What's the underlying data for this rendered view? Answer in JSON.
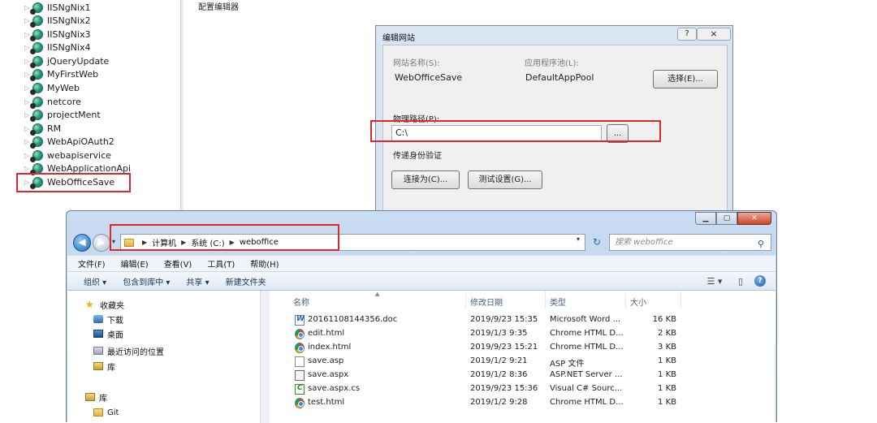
{
  "iis_tree": {
    "sites": [
      "IISNgNix1",
      "IISNgNix2",
      "IISNgNix3",
      "IISNgNix4",
      "jQueryUpdate",
      "MyFirstWeb",
      "MyWeb",
      "netcore",
      "projectMent",
      "RM",
      "WebApiOAuth2",
      "webapiservice",
      "WebApplicationApi",
      "WebOfficeSave"
    ],
    "selected": "WebOfficeSave"
  },
  "right_panel": {
    "title": "配置编辑器"
  },
  "edit_dialog": {
    "title": "编辑网站",
    "help_label": "?",
    "close_label": "×",
    "site_name_label": "网站名称(S):",
    "site_name_value": "WebOfficeSave",
    "app_pool_label": "应用程序池(L):",
    "app_pool_value": "DefaultAppPool",
    "select_button": "选择(E)...",
    "physical_path_label": "物理路径(P):",
    "physical_path_value": "C:\\",
    "browse_button": "...",
    "pass_through_label": "传递身份验证",
    "connect_as_button": "连接为(C)...",
    "test_settings_button": "测试设置(G)..."
  },
  "explorer": {
    "caption": {
      "min": "▁",
      "max": "▢",
      "close": "✕"
    },
    "nav": {
      "back": "◀",
      "forward": "▶",
      "recent": "▾"
    },
    "breadcrumb": [
      "计算机",
      "系统 (C:)",
      "weboffice"
    ],
    "address_dropdown": "▾",
    "refresh": "↻",
    "search_placeholder": "搜索 weboffice",
    "menu": [
      "文件(F)",
      "编辑(E)",
      "查看(V)",
      "工具(T)",
      "帮助(H)"
    ],
    "toolbar": [
      "组织 ▾",
      "包含到库中 ▾",
      "共享 ▾",
      "新建文件夹"
    ],
    "toolbar_icons": {
      "view": "☰ ▾",
      "preview": "▯",
      "help": "?"
    },
    "nav_pane": {
      "favorites": "收藏夹",
      "downloads": "下载",
      "desktop": "桌面",
      "recent": "最近访问的位置",
      "library_fav": "库",
      "libraries": "库",
      "git": "Git"
    },
    "columns": {
      "name": "名称",
      "modified": "修改日期",
      "type": "类型",
      "size": "大小"
    },
    "files": [
      {
        "icon": "word-doc-icon",
        "name": "20161108144356.doc",
        "modified": "2019/9/23 15:35",
        "type": "Microsoft Word ...",
        "size": "16 KB"
      },
      {
        "icon": "chrome-html-icon",
        "name": "edit.html",
        "modified": "2019/1/3 9:35",
        "type": "Chrome HTML D...",
        "size": "2 KB"
      },
      {
        "icon": "chrome-html-icon",
        "name": "index.html",
        "modified": "2019/9/23 15:21",
        "type": "Chrome HTML D...",
        "size": "3 KB"
      },
      {
        "icon": "asp-file-icon",
        "name": "save.asp",
        "modified": "2019/1/2 9:21",
        "type": "ASP 文件",
        "size": "1 KB"
      },
      {
        "icon": "aspx-file-icon",
        "name": "save.aspx",
        "modified": "2019/1/2 8:36",
        "type": "ASP.NET Server ...",
        "size": "1 KB"
      },
      {
        "icon": "csharp-file-icon",
        "name": "save.aspx.cs",
        "modified": "2019/9/23 15:36",
        "type": "Visual C# Sourc...",
        "size": "1 KB"
      },
      {
        "icon": "chrome-html-icon",
        "name": "test.html",
        "modified": "2019/1/2 9:28",
        "type": "Chrome HTML D...",
        "size": "1 KB"
      }
    ]
  },
  "colors": {
    "highlight_box": "#e0262a",
    "window_frame": "#c9dcf2"
  }
}
